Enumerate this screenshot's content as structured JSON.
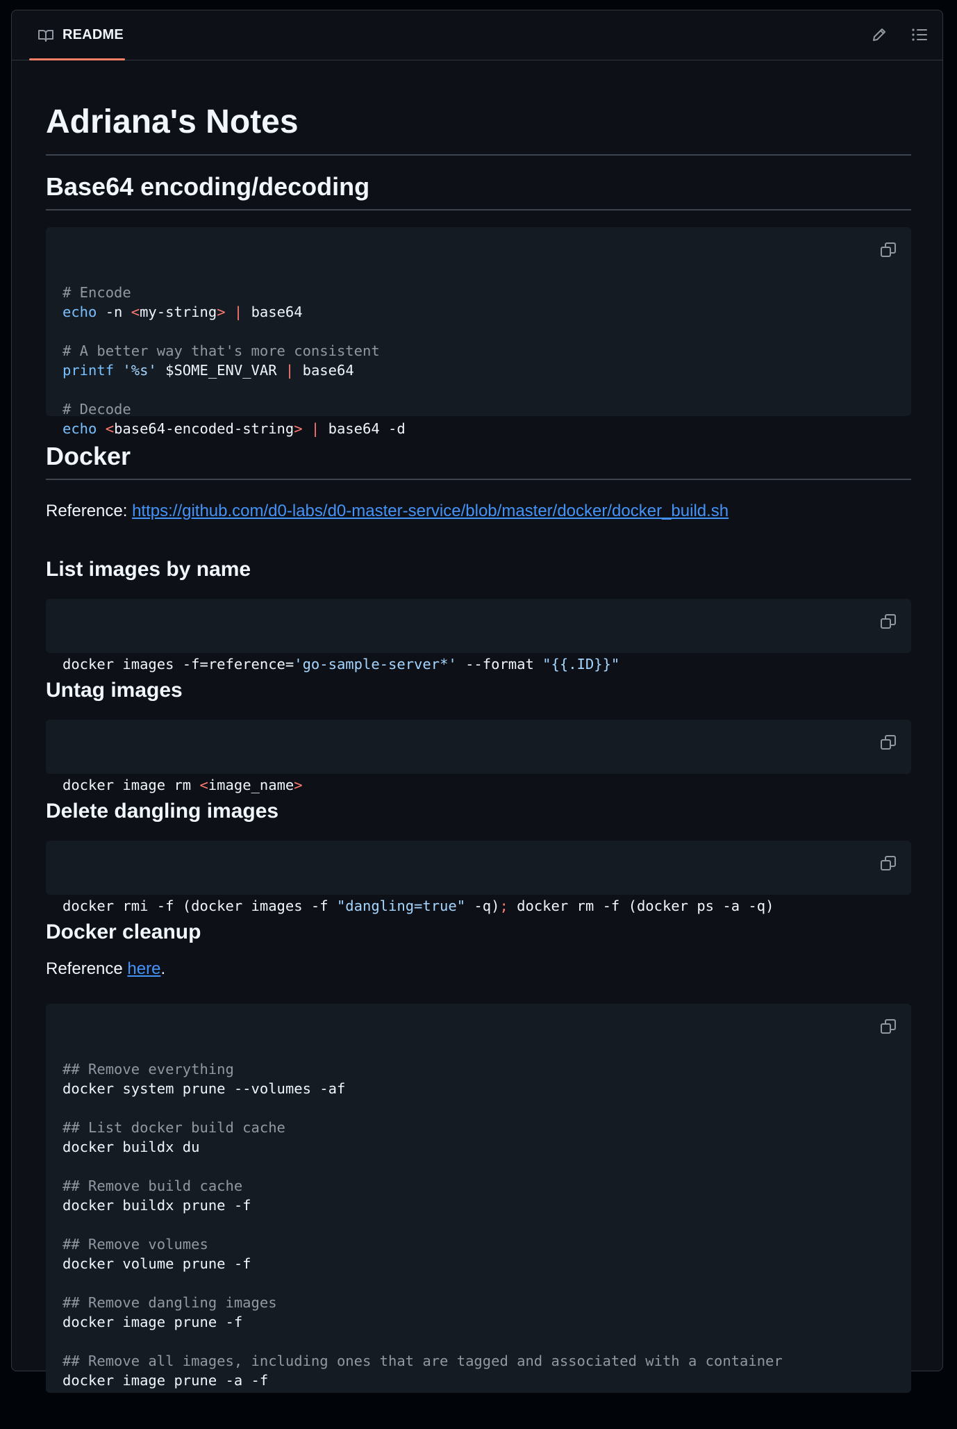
{
  "header": {
    "tab_label": "README",
    "icons": {
      "tab": "book-icon",
      "edit": "pencil-icon",
      "outline": "list-icon"
    }
  },
  "doc": {
    "title": "Adriana's Notes",
    "base64": {
      "heading": "Base64 encoding/decoding",
      "lines": [
        {
          "comment": "# Encode"
        },
        {
          "cmd": "echo",
          "a": " -n ",
          "lt": "<",
          "b": "my-string",
          "gt": ">",
          "pipe": " | ",
          "c": "base64"
        },
        {
          "blank": true
        },
        {
          "comment": "# A better way that's more consistent"
        },
        {
          "cmd": "printf",
          "a": " ",
          "str": "'%s'",
          "b": " $SOME_ENV_VAR ",
          "pipe": "|",
          "c": " base64"
        },
        {
          "blank": true
        },
        {
          "comment": "# Decode"
        },
        {
          "cmd": "echo",
          "a": " ",
          "lt": "<",
          "b": "base64-encoded-string",
          "gt": ">",
          "pipe": " | ",
          "c": "base64 -d"
        }
      ]
    },
    "docker": {
      "heading": "Docker",
      "ref_label": "Reference: ",
      "ref_link": "https://github.com/d0-labs/d0-master-service/blob/master/docker/docker_build.sh",
      "list_images": {
        "heading": "List images by name",
        "p1": "docker images -f=reference=",
        "str1": "'go-sample-server*'",
        "p2": " --format ",
        "str2": "\"{{.ID}}\""
      },
      "untag": {
        "heading": "Untag images",
        "p1": "docker image rm ",
        "lt": "<",
        "arg": "image_name",
        "gt": ">"
      },
      "dangling": {
        "heading": "Delete dangling images",
        "p1": "docker rmi -f (docker images -f ",
        "str": "\"dangling=true\"",
        "p2": " -q)",
        "semi": ";",
        "p3": " docker rm -f (docker ps -a -q)"
      },
      "cleanup": {
        "heading": "Docker cleanup",
        "ref_label": "Reference ",
        "ref_link": "here",
        "ref_end": ".",
        "lines": [
          {
            "comment": "## Remove everything"
          },
          {
            "text": "docker system prune --volumes -af"
          },
          {
            "blank": true
          },
          {
            "comment": "## List docker build cache"
          },
          {
            "text": "docker buildx du"
          },
          {
            "blank": true
          },
          {
            "comment": "## Remove build cache"
          },
          {
            "text": "docker buildx prune -f"
          },
          {
            "blank": true
          },
          {
            "comment": "## Remove volumes"
          },
          {
            "text": "docker volume prune -f"
          },
          {
            "blank": true
          },
          {
            "comment": "## Remove dangling images"
          },
          {
            "text": "docker image prune -f"
          },
          {
            "blank": true
          },
          {
            "comment": "## Remove all images, including ones that are tagged and associated with a container"
          },
          {
            "text": "docker image prune -a -f"
          }
        ]
      }
    }
  },
  "colors": {
    "background": "#0d1117",
    "code_background": "#151b23",
    "link": "#4493f8",
    "tab_underline": "#f78166",
    "comment": "#9198a1",
    "keyword": "#79c0ff",
    "operator": "#ff7b72",
    "string": "#a5d6ff"
  }
}
